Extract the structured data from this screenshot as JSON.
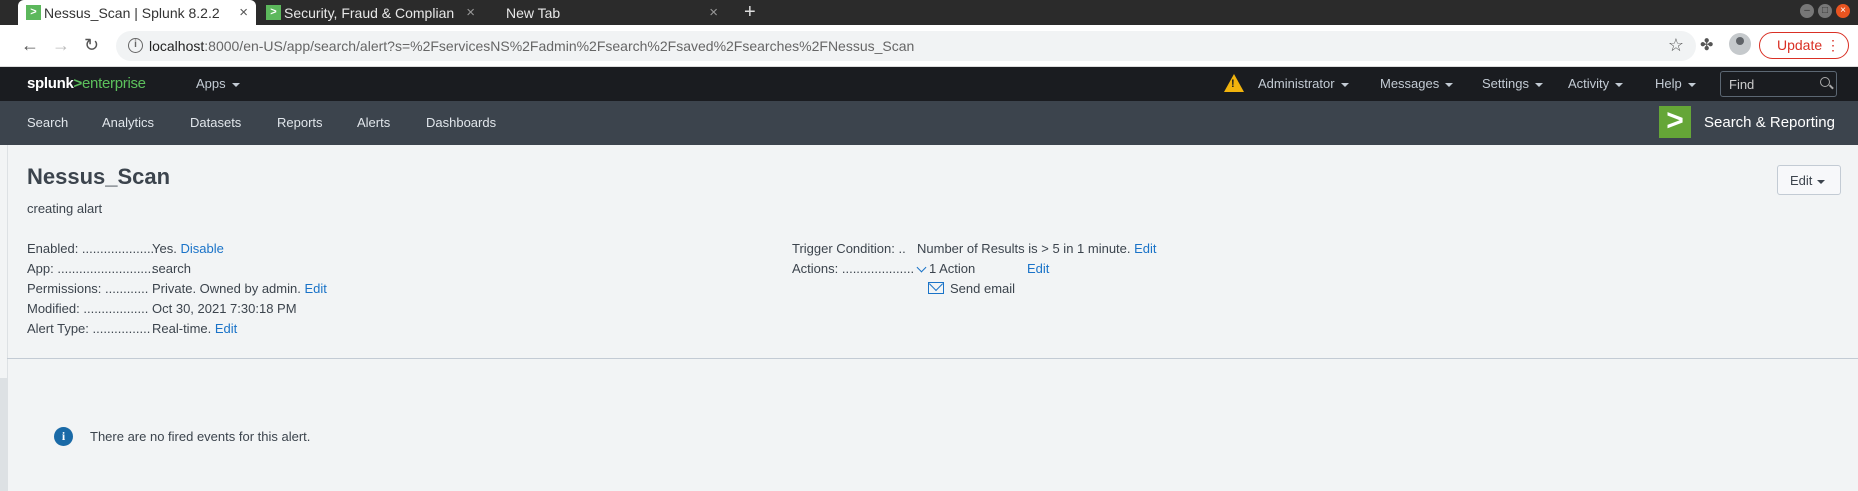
{
  "browser": {
    "tabs": [
      {
        "title": "Nessus_Scan | Splunk 8.2.2",
        "active": true
      },
      {
        "title": "Security, Fraud & Compliance",
        "active": false
      },
      {
        "title": "New Tab",
        "active": false
      }
    ],
    "new_tab_label": "+",
    "url_host": "localhost",
    "url_rest": ":8000/en-US/app/search/alert?s=%2FservicesNS%2Fadmin%2Fsearch%2Fsaved%2Fsearches%2FNessus_Scan",
    "update_label": "Update",
    "update_menu": "⋮"
  },
  "splunk_bar": {
    "logo_splunk": "splunk",
    "logo_gt": ">",
    "logo_enterprise": "enterprise",
    "apps_label": "Apps",
    "user_label": "Administrator",
    "messages_label": "Messages",
    "settings_label": "Settings",
    "activity_label": "Activity",
    "help_label": "Help",
    "find_placeholder": "Find"
  },
  "app_nav": {
    "items": [
      "Search",
      "Analytics",
      "Datasets",
      "Reports",
      "Alerts",
      "Dashboards"
    ],
    "app_logo": ">",
    "app_name": "Search & Reporting"
  },
  "alert": {
    "title": "Nessus_Scan",
    "description": "creating alart",
    "edit_label": "Edit",
    "left_props": [
      {
        "label": "Enabled: ....................",
        "value": "Yes.",
        "link": "Disable"
      },
      {
        "label": "App: ...........................",
        "value": "search",
        "link": ""
      },
      {
        "label": "Permissions: ............",
        "value": "Private. Owned by admin.",
        "link": "Edit"
      },
      {
        "label": "Modified: ..................",
        "value": "Oct 30, 2021 7:30:18 PM",
        "link": ""
      },
      {
        "label": "Alert Type: ................",
        "value": "Real-time.",
        "link": "Edit"
      }
    ],
    "trigger_label": "Trigger Condition: ..",
    "trigger_value": "Number of Results is > 5 in 1 minute.",
    "trigger_link": "Edit",
    "actions_label": "Actions: ....................",
    "actions_value": "1 Action",
    "actions_link": "Edit",
    "action_item": "Send email"
  },
  "fired_events": {
    "message": "There are no fired events for this alert."
  }
}
